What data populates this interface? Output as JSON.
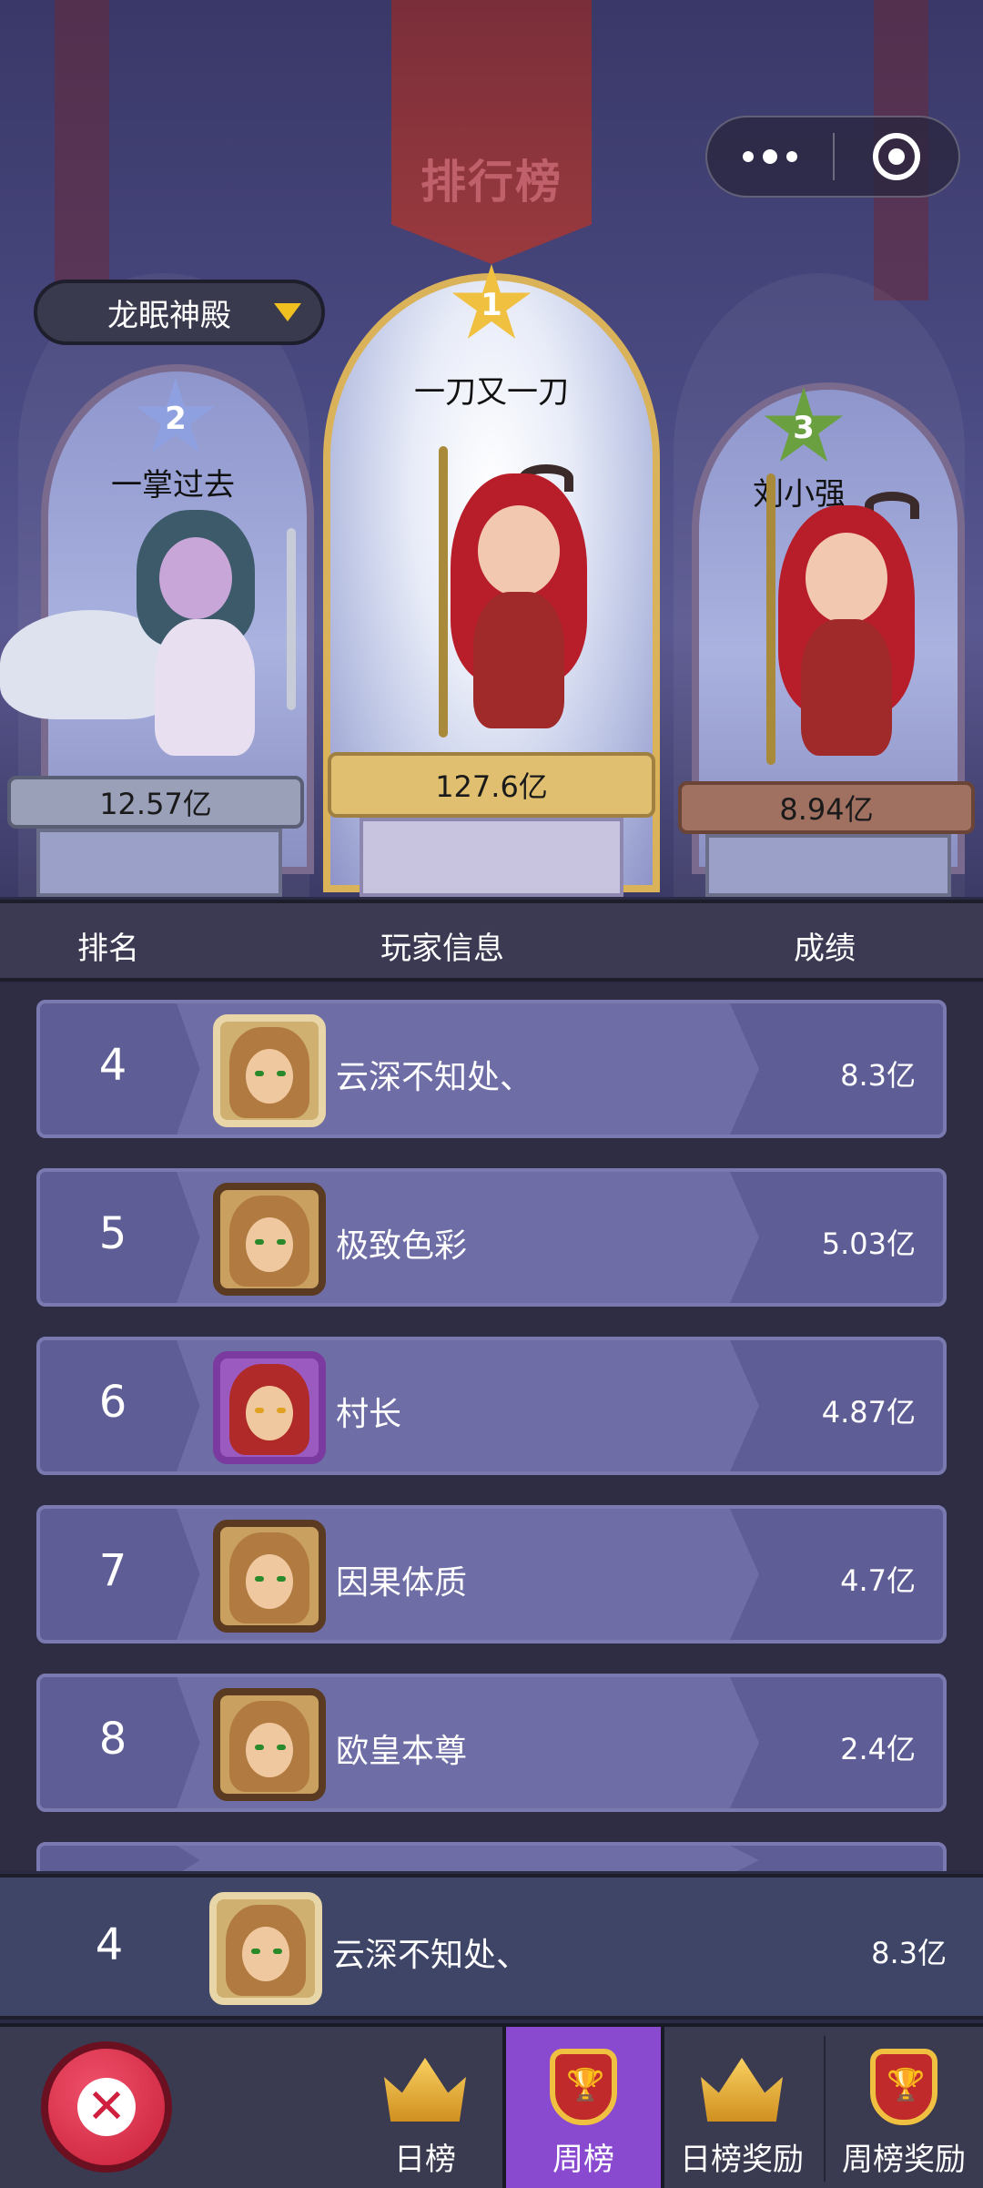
{
  "title": "排行榜",
  "server": {
    "label": "龙眠神殿"
  },
  "podium": {
    "first": {
      "rank": "1",
      "name": "一刀又一刀",
      "score": "127.6亿"
    },
    "second": {
      "rank": "2",
      "name": "一掌过去",
      "score": "12.57亿"
    },
    "third": {
      "rank": "3",
      "name": "刘小强",
      "score": "8.94亿"
    }
  },
  "table_header": {
    "rank": "排名",
    "player": "玩家信息",
    "score": "成绩"
  },
  "rows": [
    {
      "rank": "4",
      "name": "云深不知处、",
      "score": "8.3亿"
    },
    {
      "rank": "5",
      "name": "极致色彩",
      "score": "5.03亿"
    },
    {
      "rank": "6",
      "name": "村长",
      "score": "4.87亿"
    },
    {
      "rank": "7",
      "name": "因果体质",
      "score": "4.7亿"
    },
    {
      "rank": "8",
      "name": "欧皇本尊",
      "score": "2.4亿"
    }
  ],
  "my_rank": {
    "rank": "4",
    "name": "云深不知处、",
    "score": "8.3亿"
  },
  "tabs": [
    {
      "label": "日榜",
      "icon": "crown-icon"
    },
    {
      "label": "周榜",
      "icon": "trophy-shield-icon",
      "active": true
    },
    {
      "label": "日榜奖励",
      "icon": "crown-gem-icon"
    },
    {
      "label": "周榜奖励",
      "icon": "trophy-reward-icon"
    }
  ],
  "colors": {
    "active_tab": "#8a4ad0",
    "row_bg": "#5e5d95",
    "close": "#d02040"
  }
}
